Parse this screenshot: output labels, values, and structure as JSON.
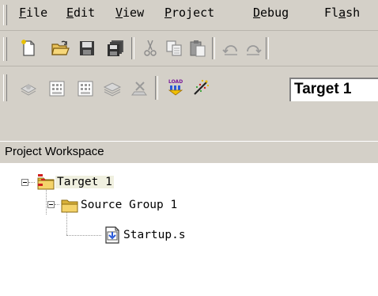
{
  "menubar": {
    "items": [
      {
        "mnemonic": "F",
        "rest": "ile"
      },
      {
        "mnemonic": "E",
        "rest": "dit"
      },
      {
        "mnemonic": "V",
        "rest": "iew"
      },
      {
        "mnemonic": "P",
        "rest": "roject"
      },
      {
        "mnemonic": "D",
        "rest": "ebug"
      },
      {
        "pre": "Fl",
        "mnemonic": "a",
        "rest": "sh"
      }
    ]
  },
  "toolbar_file": {
    "icons": [
      "new-file-icon",
      "open-folder-icon",
      "save-icon",
      "save-all-icon",
      "cut-icon",
      "copy-icon",
      "paste-icon",
      "undo-icon",
      "redo-icon"
    ]
  },
  "toolbar_build": {
    "icons": [
      "translate-icon",
      "build-target-icon",
      "rebuild-all-icon",
      "batch-build-icon",
      "stop-build-icon",
      "download-load-icon",
      "target-options-icon"
    ],
    "target_select": "Target 1"
  },
  "workspace": {
    "title": "Project Workspace",
    "tree": [
      {
        "label": "Target 1",
        "icon": "target-folder-icon"
      },
      {
        "label": "Source Group 1",
        "icon": "folder-icon"
      },
      {
        "label": "Startup.s",
        "icon": "asm-file-icon"
      }
    ]
  }
}
